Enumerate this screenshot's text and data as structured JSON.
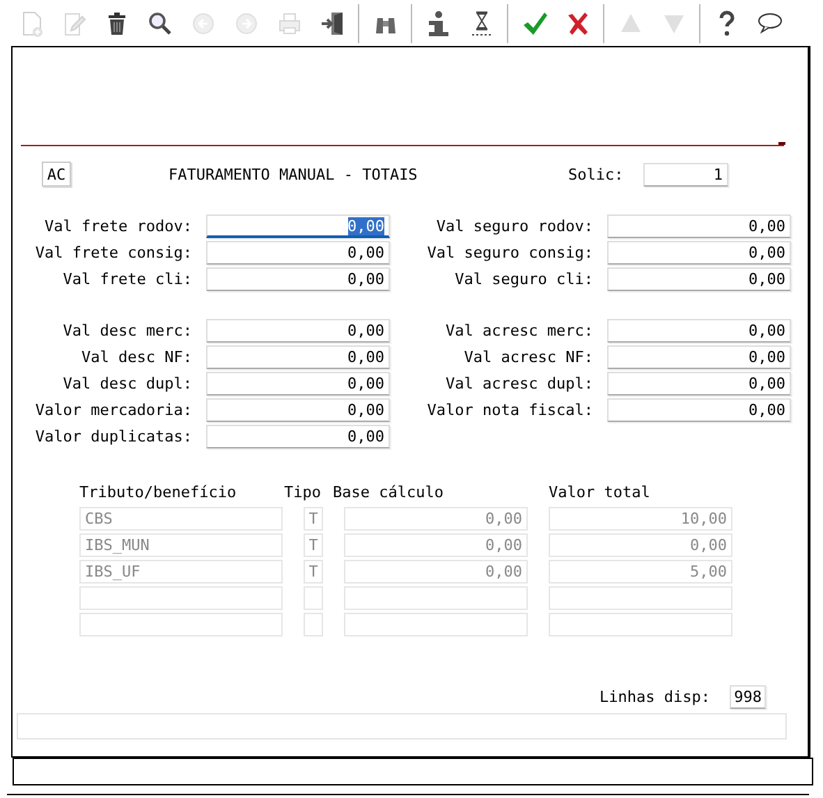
{
  "toolbar": {
    "groups": [
      [
        {
          "disabled": true
        },
        {
          "disabled": true
        },
        {
          "disabled": false
        },
        {
          "disabled": false
        },
        {
          "disabled": true
        },
        {
          "disabled": true
        },
        {
          "disabled": true
        },
        {
          "disabled": false
        }
      ],
      [
        {
          "disabled": false
        }
      ],
      [
        {
          "disabled": false
        },
        {
          "disabled": false
        }
      ],
      [
        {
          "disabled": false
        },
        {
          "disabled": false
        }
      ],
      [
        {
          "disabled": true
        },
        {
          "disabled": true
        }
      ],
      [
        {
          "disabled": false
        },
        {
          "disabled": false
        }
      ]
    ]
  },
  "header": {
    "mode_button": "AC",
    "title": "FATURAMENTO MANUAL - TOTAIS",
    "solic_label": "Solic:",
    "solic_value": "1"
  },
  "field_sections": [
    {
      "rows": [
        {
          "left": {
            "label": "Val frete rodov:",
            "value": "0,00",
            "focused": true
          },
          "right": {
            "label": "Val seguro rodov:",
            "value": "0,00",
            "focused": false
          }
        },
        {
          "left": {
            "label": "Val frete consig:",
            "value": "0,00",
            "focused": false
          },
          "right": {
            "label": "Val seguro consig:",
            "value": "0,00",
            "focused": false
          }
        },
        {
          "left": {
            "label": "Val frete cli:",
            "value": "0,00",
            "focused": false
          },
          "right": {
            "label": "Val seguro cli:",
            "value": "0,00",
            "focused": false
          }
        }
      ]
    },
    {
      "rows": [
        {
          "left": {
            "label": "Val desc merc:",
            "value": "0,00",
            "focused": false
          },
          "right": {
            "label": "Val acresc merc:",
            "value": "0,00",
            "focused": false
          }
        },
        {
          "left": {
            "label": "Val desc NF:",
            "value": "0,00",
            "focused": false
          },
          "right": {
            "label": "Val acresc NF:",
            "value": "0,00",
            "focused": false
          }
        },
        {
          "left": {
            "label": "Val desc dupl:",
            "value": "0,00",
            "focused": false
          },
          "right": {
            "label": "Val acresc dupl:",
            "value": "0,00",
            "focused": false
          }
        },
        {
          "left": {
            "label": "Valor mercadoria:",
            "value": "0,00",
            "focused": false
          },
          "right": {
            "label": "Valor nota fiscal:",
            "value": "0,00",
            "focused": false
          }
        },
        {
          "left": {
            "label": "Valor duplicatas:",
            "value": "0,00",
            "focused": false
          }
        }
      ]
    }
  ],
  "table": {
    "columns": [
      "Tributo/benefício",
      "Tipo",
      "Base cálculo",
      "Valor total"
    ],
    "rows": [
      {
        "tributo": "CBS",
        "tipo": "T",
        "base": "0,00",
        "valor": "10,00"
      },
      {
        "tributo": "IBS_MUN",
        "tipo": "T",
        "base": "0,00",
        "valor": "0,00"
      },
      {
        "tributo": "IBS_UF",
        "tipo": "T",
        "base": "0,00",
        "valor": "5,00"
      },
      {},
      {}
    ]
  },
  "lines_available": {
    "label": "Linhas disp:",
    "value": "998"
  }
}
